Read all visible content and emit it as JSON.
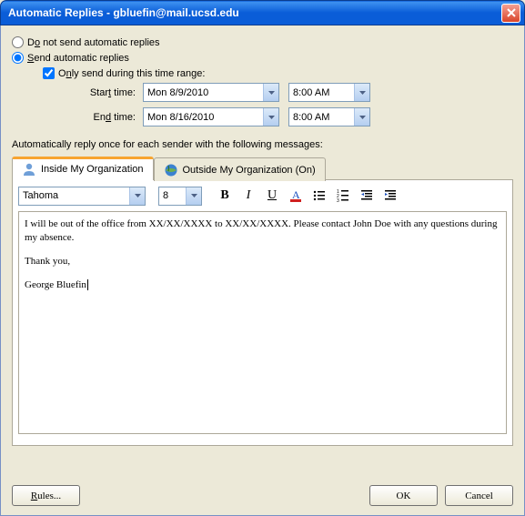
{
  "window": {
    "title": "Automatic Replies - gbluefin@mail.ucsd.edu"
  },
  "options": {
    "do_not_send": "Do not send automatic replies",
    "send": "Send automatic replies",
    "only_send_range": "Only send during this time range:",
    "start_label": "Start time:",
    "end_label": "End time:",
    "start_date": "Mon 8/9/2010",
    "start_time": "8:00 AM",
    "end_date": "Mon 8/16/2010",
    "end_time": "8:00 AM"
  },
  "instructions": "Automatically reply once for each sender with the following messages:",
  "tabs": {
    "inside": "Inside My Organization",
    "outside": "Outside My Organization (On)"
  },
  "editor": {
    "font": "Tahoma",
    "size": "8",
    "line1": "I will be out of the office from XX/XX/XXXX to XX/XX/XXXX.  Please contact John Doe with any questions during my absence.",
    "line2": "Thank you,",
    "line3": "George Bluefin"
  },
  "buttons": {
    "rules": "Rules...",
    "ok": "OK",
    "cancel": "Cancel"
  }
}
